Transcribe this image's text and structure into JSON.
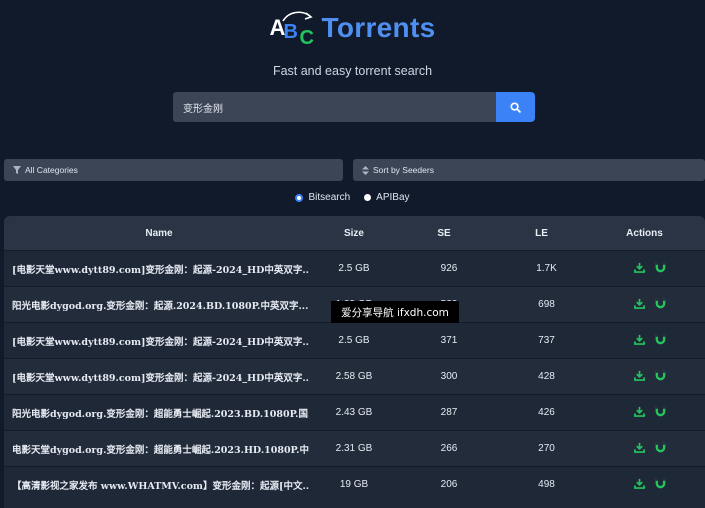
{
  "logo": {
    "a": "A",
    "b": "B",
    "c": "C",
    "text": "Torrents"
  },
  "tagline": "Fast and easy torrent search",
  "search": {
    "value": "变形金刚",
    "placeholder": ""
  },
  "filters": {
    "category": "All Categories",
    "sort": "Sort by Seeders"
  },
  "sources": [
    {
      "label": "Bitsearch",
      "selected": true
    },
    {
      "label": "APIBay",
      "selected": false
    }
  ],
  "table": {
    "headers": {
      "name": "Name",
      "size": "Size",
      "se": "SE",
      "le": "LE",
      "actions": "Actions"
    },
    "rows": [
      {
        "name": "[电影天堂www.dytt89.com]变形金刚：起源-2024_HD中英双字....",
        "size": "2.5 GB",
        "se": "926",
        "le": "1.7K"
      },
      {
        "name": "阳光电影dygod.org.变形金刚：起源.2024.BD.1080P.中英双字...",
        "size": "1.89 GB",
        "se": "538",
        "le": "698"
      },
      {
        "name": "[电影天堂www.dytt89.com]变形金刚：起源-2024_HD中英双字...",
        "size": "2.5 GB",
        "se": "371",
        "le": "737"
      },
      {
        "name": "[电影天堂www.dytt89.com]变形金刚：起源-2024_HD中英双字...",
        "size": "2.58 GB",
        "se": "300",
        "le": "428"
      },
      {
        "name": "阳光电影dygod.org.变形金刚：超能勇士崛起.2023.BD.1080P.国...",
        "size": "2.43 GB",
        "se": "287",
        "le": "426"
      },
      {
        "name": "电影天堂dygod.org.变形金刚：超能勇士崛起.2023.HD.1080P.中...",
        "size": "2.31 GB",
        "se": "266",
        "le": "270"
      },
      {
        "name": "【高清影视之家发布 www.WHATMV.com】变形金刚：起源[中文...",
        "size": "19 GB",
        "se": "206",
        "le": "498"
      }
    ]
  },
  "watermark": "爱分享导航 ifxdh.com",
  "colors": {
    "accent": "#3b82f6",
    "action": "#22c55e",
    "background": "#111a2b"
  },
  "icons": {
    "search": "search-icon",
    "filter": "filter-icon",
    "sort": "sort-icon",
    "download": "download-icon",
    "magnet": "magnet-icon"
  }
}
